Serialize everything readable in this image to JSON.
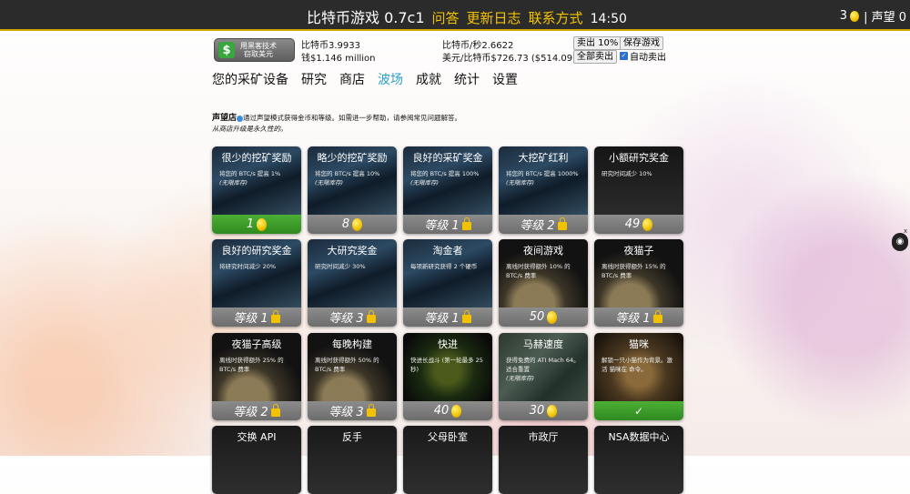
{
  "header": {
    "title": "比特币游戏 0.7c1",
    "links": [
      "问答",
      "更新日志",
      "联系方式"
    ],
    "time": "14:50",
    "coin_count": "3",
    "reputation_label": "| 声望 0"
  },
  "hack_button": {
    "line1": "用黑客技术",
    "line2": "窃取美元"
  },
  "stats": {
    "btc": "比特币3.9933",
    "money": "钱$1.146 million",
    "btc_per_sec": "比特币/秒2.6622",
    "usd_per_btc": "美元/比特币$726.73 ($514.09)"
  },
  "actions": {
    "sell_10": "卖出 10%",
    "save_game": "保存游戏",
    "sell_all": "全部卖出",
    "auto_sell": "自动卖出"
  },
  "tabs": [
    "您的采矿设备",
    "研究",
    "商店",
    "波场",
    "成就",
    "统计",
    "设置"
  ],
  "active_tab": "波场",
  "shop_info": {
    "title": "声望店",
    "line1": "通过声望模式获得金币和等级。如需进一步帮助，请参阅常见问题解答。",
    "line2": "从商店升级是永久性的。"
  },
  "cards": [
    {
      "title": "很少的挖矿奖励",
      "desc": "将您的 BTC/s 提高 1%",
      "note": "(无限库存)",
      "footer": "1",
      "footer_type": "coin",
      "footer_style": "green"
    },
    {
      "title": "略少的挖矿奖励",
      "desc": "将您的 BTC/s 提高 10%",
      "note": "(无限库存)",
      "footer": "8",
      "footer_type": "coin",
      "footer_style": "gray"
    },
    {
      "title": "良好的采矿奖金",
      "desc": "将您的 BTC/s 提高 100%",
      "note": "(无限库存)",
      "footer": "等级 1",
      "footer_type": "lock",
      "footer_style": "gray"
    },
    {
      "title": "大挖矿红利",
      "desc": "将您的 BTC/s 提高 1000%",
      "note": "(无限库存)",
      "footer": "等级 2",
      "footer_type": "lock",
      "footer_style": "gray"
    },
    {
      "title": "小额研究奖金",
      "desc": "研究时间减少 10%",
      "note": "",
      "footer": "49",
      "footer_type": "coin",
      "footer_style": "gray"
    },
    {
      "title": "良好的研究奖金",
      "desc": "将研究时间减少 20%",
      "note": "",
      "footer": "等级 1",
      "footer_type": "lock",
      "footer_style": "gray"
    },
    {
      "title": "大研究奖金",
      "desc": "研究时间减少 30%",
      "note": "",
      "footer": "等级 3",
      "footer_type": "lock",
      "footer_style": "gray"
    },
    {
      "title": "淘金者",
      "desc": "每项新研究获得 2 个硬币",
      "note": "",
      "footer": "等级 1",
      "footer_type": "lock",
      "footer_style": "gray"
    },
    {
      "title": "夜间游戏",
      "desc": "离线时获得额外 10% 的 BTC/s 费率",
      "note": "",
      "footer": "50",
      "footer_type": "coin",
      "footer_style": "gray"
    },
    {
      "title": "夜猫子",
      "desc": "离线时获得额外 15% 的 BTC/s 费率",
      "note": "",
      "footer": "等级 1",
      "footer_type": "lock",
      "footer_style": "gray"
    },
    {
      "title": "夜猫子高级",
      "desc": "离线时获得额外 25% 的 BTC/s 费率",
      "note": "",
      "footer": "等级 2",
      "footer_type": "lock",
      "footer_style": "gray"
    },
    {
      "title": "每晚构建",
      "desc": "离线时获得额外 50% 的 BTC/s 费率",
      "note": "",
      "footer": "等级 3",
      "footer_type": "lock",
      "footer_style": "gray"
    },
    {
      "title": "快进",
      "desc": "快进长战斗 (第一轮最多 25秒)",
      "note": "",
      "footer": "40",
      "footer_type": "coin",
      "footer_style": "gray"
    },
    {
      "title": "马赫速度",
      "desc": "获得免费的 ATI Mach 64。适合重置",
      "note": "(无限库存)",
      "footer": "30",
      "footer_type": "coin",
      "footer_style": "gray"
    },
    {
      "title": "猫咪",
      "desc": "解锁一只小猫作为背景。激活 猫咪在 命令。",
      "note": "",
      "footer": "",
      "footer_type": "check",
      "footer_style": "green"
    },
    {
      "title": "交换 API",
      "desc": "",
      "note": "",
      "footer": "",
      "footer_type": "none",
      "footer_style": "gray"
    },
    {
      "title": "反手",
      "desc": "",
      "note": "",
      "footer": "",
      "footer_type": "none",
      "footer_style": "gray"
    },
    {
      "title": "父母卧室",
      "desc": "",
      "note": "",
      "footer": "",
      "footer_type": "none",
      "footer_style": "gray"
    },
    {
      "title": "市政厅",
      "desc": "",
      "note": "",
      "footer": "",
      "footer_type": "none",
      "footer_style": "gray"
    },
    {
      "title": "NSA数据中心",
      "desc": "",
      "note": "",
      "footer": "",
      "footer_type": "none",
      "footer_style": "gray"
    }
  ],
  "colors": {
    "accent": "#f5c400",
    "active_tab": "#2aa0c8",
    "green": "#3ba22b"
  }
}
